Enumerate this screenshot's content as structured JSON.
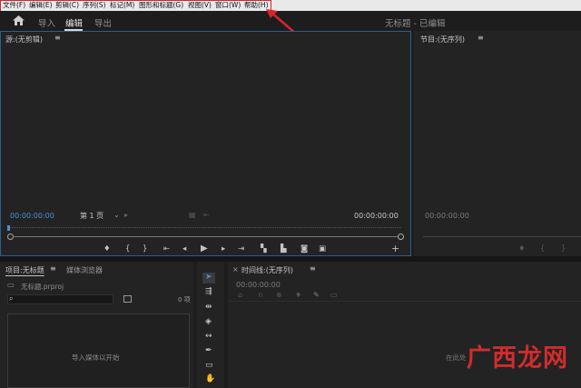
{
  "menubar": {
    "items": [
      "文件(F)",
      "编辑(E)",
      "剪辑(C)",
      "序列(S)",
      "标记(M)",
      "图形和标题(G)",
      "视图(V)",
      "窗口(W)",
      "帮助(H)"
    ]
  },
  "workspace": {
    "tabs": [
      "导入",
      "编辑",
      "导出"
    ],
    "active_tab": "编辑",
    "project_status": "无标题 - 已编辑"
  },
  "source_monitor": {
    "title": "源:(无剪辑)",
    "timecode_left": "00:00:00:00",
    "page_selector": "第 1 页",
    "timecode_right": "00:00:00:00"
  },
  "program_monitor": {
    "title": "节目:(无序列)",
    "timecode_left": "00:00:00:00"
  },
  "project_panel": {
    "tab_project": "项目:无标题",
    "tab_media": "媒体浏览器",
    "file_name": "无标题.prproj",
    "item_count": "0 项",
    "empty_hint": "导入媒体以开始"
  },
  "timeline": {
    "title": "时间线:(无序列)",
    "timecode": "00:00:00:00",
    "empty_hint": "在此处"
  },
  "watermark": {
    "text": "广西龙网"
  },
  "colors": {
    "accent_blue": "#4a8fd9",
    "highlight_red": "#d9242a",
    "watermark_red": "#d12c2c"
  }
}
